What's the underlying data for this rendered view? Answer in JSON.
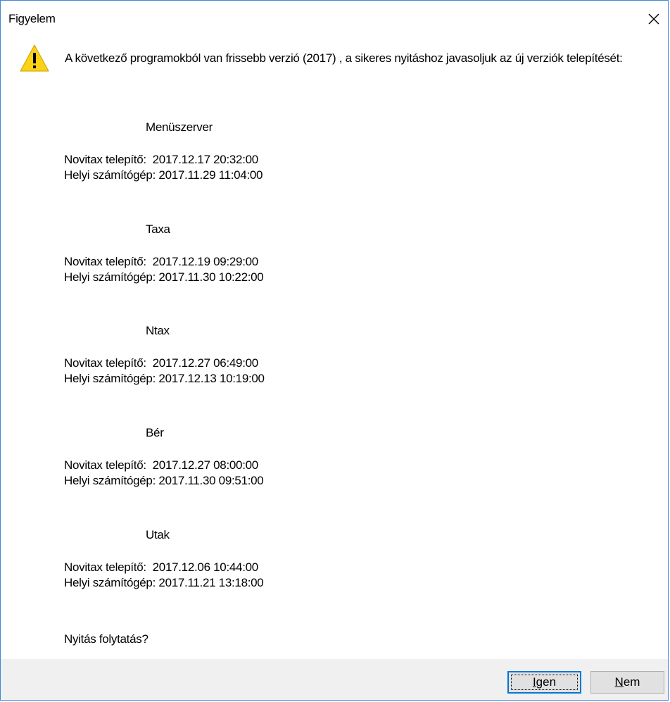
{
  "window": {
    "title": "Figyelem",
    "close_icon": "close-icon"
  },
  "message": {
    "icon": "warning-icon",
    "text": "A következő programokból van frissebb verzió (2017) , a sikeres nyitáshoz javasoljuk az új verziók telepítését:"
  },
  "programs": [
    {
      "name": "Menüszerver",
      "installer_label": "Novitax telepítő:  2017.12.17 20:32:00",
      "local_label": "Helyi számítógép: 2017.11.29 11:04:00"
    },
    {
      "name": "Taxa",
      "installer_label": "Novitax telepítő:  2017.12.19 09:29:00",
      "local_label": "Helyi számítógép: 2017.11.30 10:22:00"
    },
    {
      "name": "Ntax",
      "installer_label": "Novitax telepítő:  2017.12.27 06:49:00",
      "local_label": "Helyi számítógép: 2017.12.13 10:19:00"
    },
    {
      "name": "Bér",
      "installer_label": "Novitax telepítő:  2017.12.27 08:00:00",
      "local_label": "Helyi számítógép: 2017.11.30 09:51:00"
    },
    {
      "name": "Utak",
      "installer_label": "Novitax telepítő:  2017.12.06 10:44:00",
      "local_label": "Helyi számítógép: 2017.11.21 13:18:00"
    }
  ],
  "question": "Nyitás folytatás?",
  "buttons": {
    "yes_first": "I",
    "yes_rest": "gen",
    "no_first": "N",
    "no_rest": "em"
  },
  "colors": {
    "window_border": "#3c88d4",
    "footer_bg": "#f0f0f0",
    "default_button_border": "#0078d7",
    "warning_fill": "#fcd116"
  }
}
